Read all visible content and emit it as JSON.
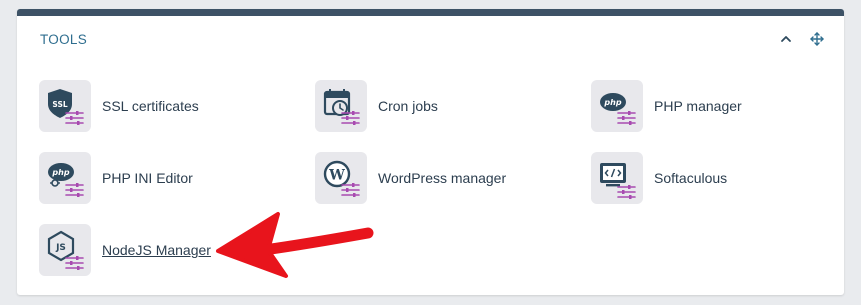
{
  "panel": {
    "title": "TOOLS",
    "collapse_icon": "chevron-up-icon",
    "move_icon": "move-arrows-icon"
  },
  "tools": [
    {
      "label": "SSL certificates",
      "icon": "ssl-shield-icon"
    },
    {
      "label": "Cron jobs",
      "icon": "calendar-clock-icon"
    },
    {
      "label": "PHP manager",
      "icon": "php-icon"
    },
    {
      "label": "PHP INI Editor",
      "icon": "php-ini-icon"
    },
    {
      "label": "WordPress manager",
      "icon": "wordpress-icon"
    },
    {
      "label": "Softaculous",
      "icon": "code-monitor-icon"
    },
    {
      "label": "NodeJS Manager",
      "icon": "nodejs-icon"
    }
  ],
  "colors": {
    "accent_bar": "#3d5266",
    "title": "#2f6e8f",
    "sliders": "#a84ab0",
    "icon_dark": "#2e4a5e",
    "arrow": "#e8141c"
  }
}
